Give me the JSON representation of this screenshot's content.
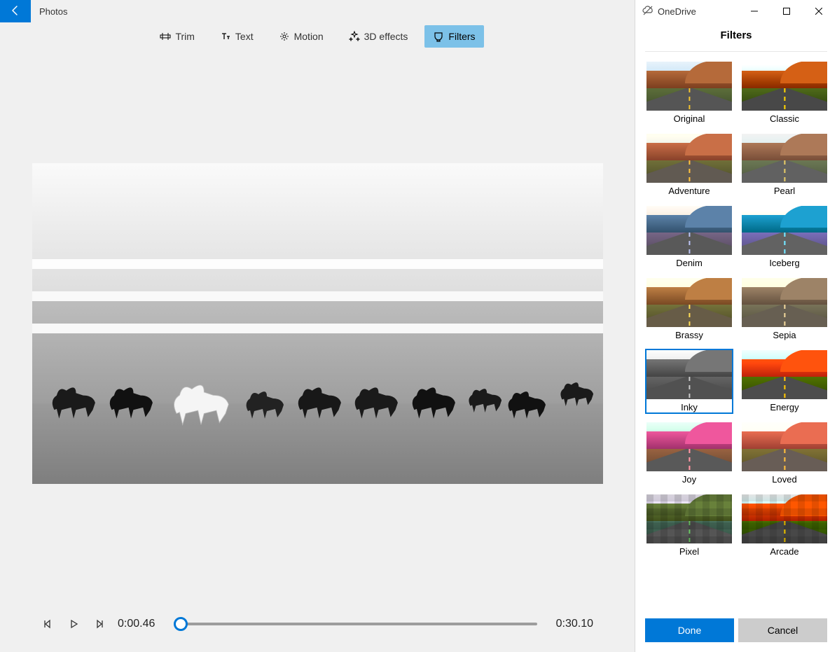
{
  "app": {
    "title": "Photos"
  },
  "titlebar": {
    "onedrive_label": "OneDrive"
  },
  "toolbar": {
    "items": [
      {
        "id": "trim",
        "label": "Trim",
        "icon": "trim-icon"
      },
      {
        "id": "text",
        "label": "Text",
        "icon": "text-icon"
      },
      {
        "id": "motion",
        "label": "Motion",
        "icon": "motion-icon"
      },
      {
        "id": "3deffects",
        "label": "3D effects",
        "icon": "sparkle-icon"
      },
      {
        "id": "filters",
        "label": "Filters",
        "icon": "filter-brush-icon"
      }
    ],
    "selected": "filters"
  },
  "transport": {
    "current_time": "0:00.46",
    "total_time": "0:30.10",
    "progress_pct": 2
  },
  "panel": {
    "heading": "Filters",
    "filters": [
      {
        "id": "original",
        "label": "Original",
        "cls": "flt-original"
      },
      {
        "id": "classic",
        "label": "Classic",
        "cls": "flt-classic"
      },
      {
        "id": "adventure",
        "label": "Adventure",
        "cls": "flt-adventure"
      },
      {
        "id": "pearl",
        "label": "Pearl",
        "cls": "flt-pearl"
      },
      {
        "id": "denim",
        "label": "Denim",
        "cls": "flt-denim"
      },
      {
        "id": "iceberg",
        "label": "Iceberg",
        "cls": "flt-iceberg"
      },
      {
        "id": "brassy",
        "label": "Brassy",
        "cls": "flt-brassy"
      },
      {
        "id": "sepia",
        "label": "Sepia",
        "cls": "flt-sepia"
      },
      {
        "id": "inky",
        "label": "Inky",
        "cls": "flt-inky"
      },
      {
        "id": "energy",
        "label": "Energy",
        "cls": "flt-energy"
      },
      {
        "id": "joy",
        "label": "Joy",
        "cls": "flt-joy"
      },
      {
        "id": "loved",
        "label": "Loved",
        "cls": "flt-loved"
      },
      {
        "id": "pixel",
        "label": "Pixel",
        "cls": "flt-pixel"
      },
      {
        "id": "arcade",
        "label": "Arcade",
        "cls": "flt-arcade"
      }
    ],
    "selected_filter": "inky",
    "buttons": {
      "done": "Done",
      "cancel": "Cancel"
    }
  }
}
